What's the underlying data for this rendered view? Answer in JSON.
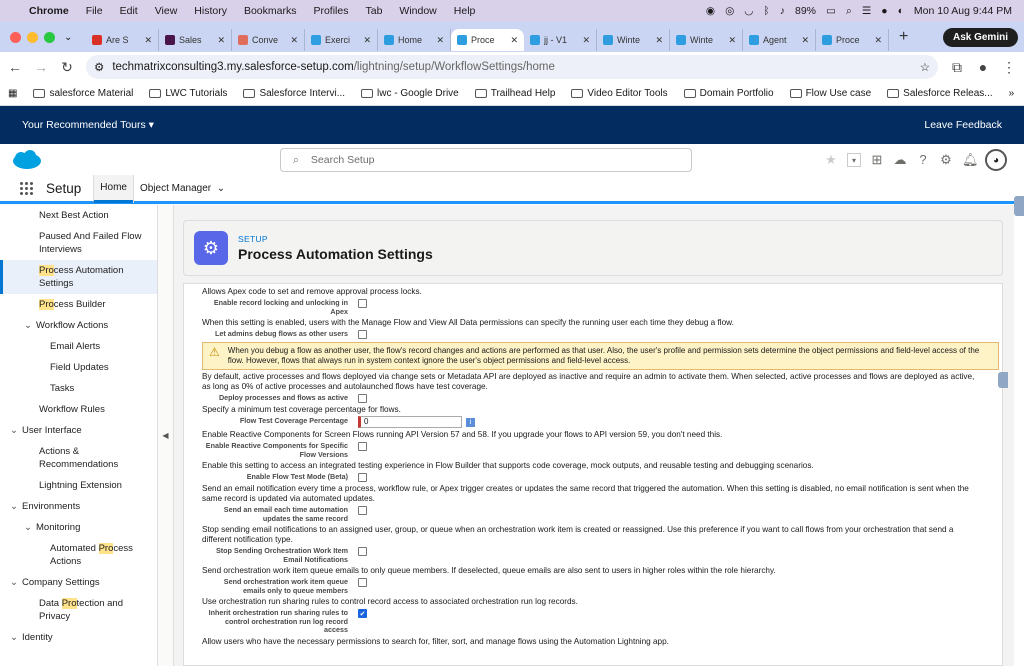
{
  "menubar": {
    "app": "Chrome",
    "items": [
      "File",
      "Edit",
      "View",
      "History",
      "Bookmarks",
      "Profiles",
      "Tab",
      "Window",
      "Help"
    ],
    "battery": "89%",
    "datetime": "Mon 10 Aug  9:44 PM"
  },
  "tabs": [
    {
      "title": "Are S",
      "color": "#d93025"
    },
    {
      "title": "Sales",
      "color": "#4a154b"
    },
    {
      "title": "Conve",
      "color": "#e06c5c"
    },
    {
      "title": "Exerci",
      "color": "#2f9ee0"
    },
    {
      "title": "Home",
      "color": "#2f9ee0"
    },
    {
      "title": "Proce",
      "color": "#2f9ee0",
      "active": true
    },
    {
      "title": "jj - V1",
      "color": "#2f9ee0"
    },
    {
      "title": "Winte",
      "color": "#2f9ee0"
    },
    {
      "title": "Winte",
      "color": "#2f9ee0"
    },
    {
      "title": "Agent",
      "color": "#2f9ee0"
    },
    {
      "title": "Proce",
      "color": "#2f9ee0"
    }
  ],
  "ask_gemini": "Ask Gemini",
  "url": {
    "host": "techmatrixconsulting3.my.salesforce-setup.com",
    "path": "/lightning/setup/WorkflowSettings/home"
  },
  "bookmarks": [
    "salesforce Material",
    "LWC Tutorials",
    "Salesforce Intervi...",
    "lwc - Google Drive",
    "Trailhead Help",
    "Video Editor Tools",
    "Domain Portfolio",
    "Flow Use case",
    "Salesforce Releas..."
  ],
  "tours": {
    "label": "Your Recommended Tours",
    "feedback": "Leave Feedback"
  },
  "search": {
    "placeholder": "Search Setup"
  },
  "setup": {
    "title": "Setup",
    "home": "Home",
    "object_manager": "Object Manager"
  },
  "sidebar": [
    {
      "text": "Next Best Action",
      "indent": 1
    },
    {
      "text": "Paused And Failed Flow Interviews",
      "indent": 1
    },
    {
      "pre": "",
      "hl": "Pro",
      "post": "cess Automation Settings",
      "indent": 1,
      "active": true
    },
    {
      "pre": "",
      "hl": "Pro",
      "post": "cess Builder",
      "indent": 1
    },
    {
      "text": "Workflow Actions",
      "indent": 1,
      "chev": "⌄"
    },
    {
      "text": "Email Alerts",
      "indent": 2
    },
    {
      "text": "Field Updates",
      "indent": 2
    },
    {
      "text": "Tasks",
      "indent": 2
    },
    {
      "text": "Workflow Rules",
      "indent": 1
    },
    {
      "text": "User Interface",
      "indent": 0,
      "chev": "⌄"
    },
    {
      "text": "Actions & Recommendations",
      "indent": 1
    },
    {
      "text": "Lightning Extension",
      "indent": 1
    },
    {
      "text": "Environments",
      "indent": 0,
      "chev": "⌄"
    },
    {
      "text": "Monitoring",
      "indent": 1,
      "chev": "⌄"
    },
    {
      "pre": "Automated ",
      "hl": "Pro",
      "post": "cess Actions",
      "indent": 2
    },
    {
      "text": "Company Settings",
      "indent": 0,
      "chev": "⌄"
    },
    {
      "pre": "Data ",
      "hl": "Pro",
      "post": "tection and Privacy",
      "indent": 1
    },
    {
      "text": "Identity",
      "indent": 0,
      "chev": "⌄"
    }
  ],
  "page": {
    "label": "SETUP",
    "title": "Process Automation Settings"
  },
  "settings": [
    {
      "desc": "Allows Apex code to set and remove approval process locks."
    },
    {
      "label": "Enable record locking and unlocking in Apex",
      "checked": false
    },
    {
      "desc": "When this setting is enabled, users with the Manage Flow and View All Data permissions can specify the running user each time they debug a flow."
    },
    {
      "label": "Let admins debug flows as other users",
      "checked": false
    },
    {
      "warning": "When you debug a flow as another user, the flow's record changes and actions are performed as that user. Also, the user's profile and permission sets determine the object permissions and field-level access of the flow. However, flows that always run in system context ignore the user's object permissions and field-level access."
    },
    {
      "desc": "By default, active processes and flows deployed via change sets or Metadata API are deployed as inactive and require an admin to activate them. When selected, active processes and flows are deployed as active, as long as 0% of active processes and autolaunched flows have test coverage."
    },
    {
      "label": "Deploy processes and flows as active",
      "checked": false
    },
    {
      "desc": "Specify a minimum test coverage percentage for flows."
    },
    {
      "label": "Flow Test Coverage Percentage",
      "input": "0"
    },
    {
      "desc": "Enable Reactive Components for Screen Flows running API Version 57 and 58. If you upgrade your flows to API version 59, you don't need this."
    },
    {
      "label": "Enable Reactive Components for Specific Flow Versions",
      "checked": false
    },
    {
      "desc": "Enable this setting to access an integrated testing experience in Flow Builder that supports code coverage, mock outputs, and reusable testing and debugging scenarios."
    },
    {
      "label": "Enable Flow Test Mode (Beta)",
      "checked": false
    },
    {
      "desc": "Send an email notification every time a process, workflow rule, or Apex trigger creates or updates the same record that triggered the automation. When this setting is disabled, no email notification is sent when the same record is updated via automated updates."
    },
    {
      "label": "Send an email each time automation updates the same record",
      "checked": false
    },
    {
      "desc": "Stop sending email notifications to an assigned user, group, or queue when an orchestration work item is created or reassigned. Use this preference if you want to call flows from your orchestration that send a different notification type."
    },
    {
      "label": "Stop Sending Orchestration Work Item Email Notifications",
      "checked": false
    },
    {
      "desc": "Send orchestration work item queue emails to only queue members. If deselected, queue emails are also sent to users in higher roles within the role hierarchy."
    },
    {
      "label": "Send orchestration work item queue emails only to queue members",
      "checked": false
    },
    {
      "desc": "Use orchestration run sharing rules to control record access to associated orchestration run log records."
    },
    {
      "label": "Inherit orchestration run sharing rules to control orchestration run log record access",
      "checked": true
    },
    {
      "desc": "Allow users who have the necessary permissions to search for, filter, sort, and manage flows using the Automation Lightning app."
    }
  ]
}
